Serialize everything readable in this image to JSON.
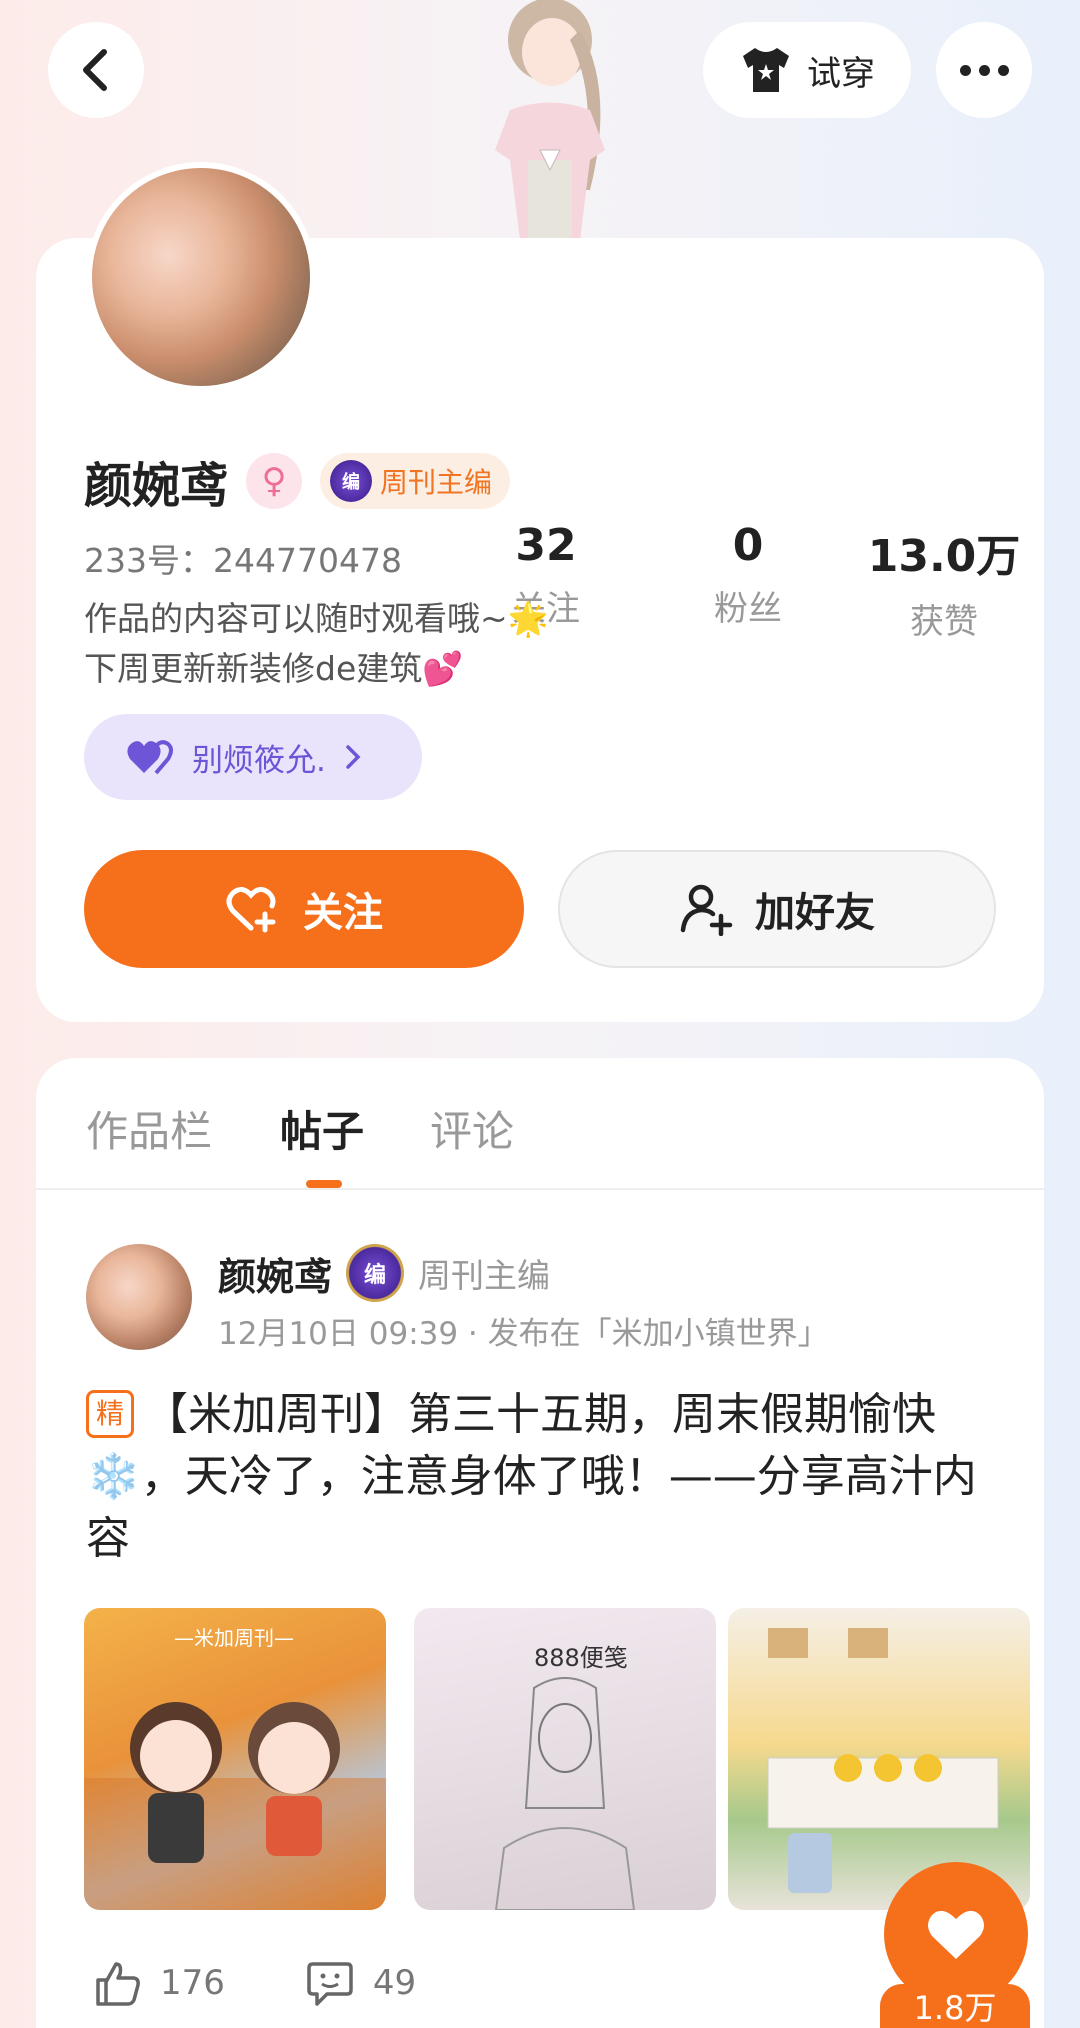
{
  "header": {
    "tryon_label": "试穿",
    "icons": [
      "chevron-left-icon",
      "tshirt-icon",
      "more-icon"
    ]
  },
  "profile": {
    "name": "颜婉鸢",
    "gender_icon": "female-icon",
    "title_badge": "周刊主编",
    "uid": "233号：244770478",
    "bio_line1": "作品的内容可以随时观看哦~🌟",
    "bio_line2": "下周更新新装修de建筑💕",
    "group_label": "别烦筱允.",
    "stats": [
      {
        "value": "32",
        "label": "关注"
      },
      {
        "value": "0",
        "label": "粉丝"
      },
      {
        "value": "13.0万",
        "label": "获赞"
      }
    ],
    "follow_label": "关注",
    "add_friend_label": "加好友"
  },
  "tabs": [
    {
      "label": "作品栏",
      "active": false
    },
    {
      "label": "帖子",
      "active": true
    },
    {
      "label": "评论",
      "active": false
    }
  ],
  "post": {
    "author": "颜婉鸢",
    "role": "周刊主编",
    "meta": "12月10日 09:39 · 发布在「米加小镇世界」",
    "tag": "精",
    "text": "【米加周刊】第三十五期，周末假期愉快❄️，天冷了，注意身体了哦！——分享高汁内容",
    "thumb_captions": [
      "—米加周刊—",
      "888便笺"
    ],
    "likes": "176",
    "comments": "49"
  },
  "floating_like": {
    "count": "1.8万"
  },
  "colors": {
    "accent": "#f6701c",
    "group_purple": "#6e54d6"
  }
}
